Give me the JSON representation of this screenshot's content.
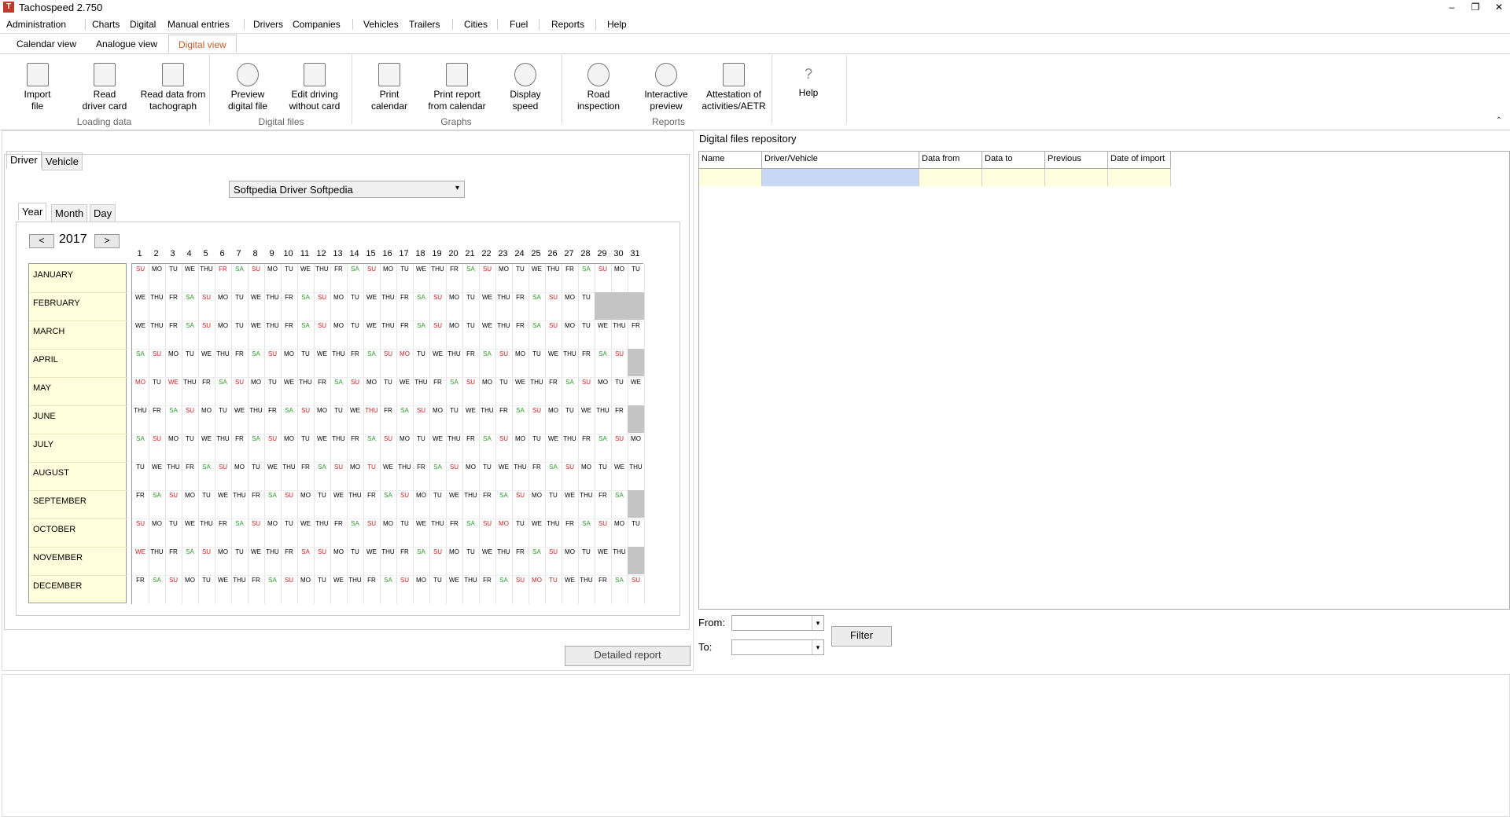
{
  "window": {
    "title": "Tachospeed 2.750",
    "minimize": "–",
    "restore": "❐",
    "close": "✕"
  },
  "menu": [
    {
      "label": "Administration"
    },
    {
      "label": "Charts"
    },
    {
      "label": "Digital"
    },
    {
      "label": "Manual entries"
    },
    {
      "label": "Drivers"
    },
    {
      "label": "Companies"
    },
    {
      "label": "Vehicles"
    },
    {
      "label": "Trailers"
    },
    {
      "label": "Cities"
    },
    {
      "label": "Fuel"
    },
    {
      "label": "Reports"
    },
    {
      "label": "Help"
    }
  ],
  "view_tabs": [
    {
      "label": "Calendar view"
    },
    {
      "label": "Analogue view"
    },
    {
      "label": "Digital view",
      "active": true
    }
  ],
  "ribbon": {
    "buttons": [
      {
        "line1": "Import",
        "line2": "file",
        "icon": "folder-icon"
      },
      {
        "line1": "Read",
        "line2": "driver card",
        "icon": "card-reader-icon"
      },
      {
        "line1": "Read data from",
        "line2": "tachograph",
        "icon": "tachograph-icon"
      },
      {
        "line1": "Preview",
        "line2": "digital file",
        "icon": "magnifier-icon"
      },
      {
        "line1": "Edit driving",
        "line2": "without card",
        "icon": "edit-card-icon"
      },
      {
        "line1": "Print",
        "line2": "calendar",
        "icon": "printer-icon"
      },
      {
        "line1": "Print report",
        "line2": "from calendar",
        "icon": "printer-icon"
      },
      {
        "line1": "Display",
        "line2": "speed",
        "icon": "speedometer-icon"
      },
      {
        "line1": "Road",
        "line2": "inspection",
        "icon": "officer-icon"
      },
      {
        "line1": "Interactive",
        "line2": "preview",
        "icon": "magnifier-chart-icon"
      },
      {
        "line1": "Attestation of",
        "line2": "activities/AETR",
        "icon": "document-icon"
      },
      {
        "line1": "Help",
        "line2": "",
        "icon": "question-icon"
      }
    ],
    "groups": [
      "Loading data",
      "Digital files",
      "Graphs",
      "Reports"
    ]
  },
  "left": {
    "tabs": [
      {
        "label": "Driver"
      },
      {
        "label": "Vehicle"
      }
    ],
    "driver_select": "Softpedia Driver Softpedia",
    "period_tabs": [
      {
        "label": "Year"
      },
      {
        "label": "Month"
      },
      {
        "label": "Day"
      }
    ],
    "prev": "<",
    "next": ">",
    "year": "2017",
    "detailed_report": "Detailed report"
  },
  "calendar": {
    "day_numbers": [
      "1",
      "2",
      "3",
      "4",
      "5",
      "6",
      "7",
      "8",
      "9",
      "10",
      "11",
      "12",
      "13",
      "14",
      "15",
      "16",
      "17",
      "18",
      "19",
      "20",
      "21",
      "22",
      "23",
      "24",
      "25",
      "26",
      "27",
      "28",
      "29",
      "30",
      "31"
    ],
    "months": [
      {
        "name": "JANUARY",
        "days": [
          "SU",
          "MO",
          "TU",
          "WE",
          "THU",
          "FR",
          "SA",
          "SU",
          "MO",
          "TU",
          "WE",
          "THU",
          "FR",
          "SA",
          "SU",
          "MO",
          "TU",
          "WE",
          "THU",
          "FR",
          "SA",
          "SU",
          "MO",
          "TU",
          "WE",
          "THU",
          "FR",
          "SA",
          "SU",
          "MO",
          "TU"
        ]
      },
      {
        "name": "FEBRUARY",
        "days": [
          "WE",
          "THU",
          "FR",
          "SA",
          "SU",
          "MO",
          "TU",
          "WE",
          "THU",
          "FR",
          "SA",
          "SU",
          "MO",
          "TU",
          "WE",
          "THU",
          "FR",
          "SA",
          "SU",
          "MO",
          "TU",
          "WE",
          "THU",
          "FR",
          "SA",
          "SU",
          "MO",
          "TU"
        ]
      },
      {
        "name": "MARCH",
        "days": [
          "WE",
          "THU",
          "FR",
          "SA",
          "SU",
          "MO",
          "TU",
          "WE",
          "THU",
          "FR",
          "SA",
          "SU",
          "MO",
          "TU",
          "WE",
          "THU",
          "FR",
          "SA",
          "SU",
          "MO",
          "TU",
          "WE",
          "THU",
          "FR",
          "SA",
          "SU",
          "MO",
          "TU",
          "WE",
          "THU",
          "FR"
        ]
      },
      {
        "name": "APRIL",
        "days": [
          "SA",
          "SU",
          "MO",
          "TU",
          "WE",
          "THU",
          "FR",
          "SA",
          "SU",
          "MO",
          "TU",
          "WE",
          "THU",
          "FR",
          "SA",
          "SU",
          "MO",
          "TU",
          "WE",
          "THU",
          "FR",
          "SA",
          "SU",
          "MO",
          "TU",
          "WE",
          "THU",
          "FR",
          "SA",
          "SU"
        ]
      },
      {
        "name": "MAY",
        "days": [
          "MO",
          "TU",
          "WE",
          "THU",
          "FR",
          "SA",
          "SU",
          "MO",
          "TU",
          "WE",
          "THU",
          "FR",
          "SA",
          "SU",
          "MO",
          "TU",
          "WE",
          "THU",
          "FR",
          "SA",
          "SU",
          "MO",
          "TU",
          "WE",
          "THU",
          "FR",
          "SA",
          "SU",
          "MO",
          "TU",
          "WE"
        ]
      },
      {
        "name": "JUNE",
        "days": [
          "THU",
          "FR",
          "SA",
          "SU",
          "MO",
          "TU",
          "WE",
          "THU",
          "FR",
          "SA",
          "SU",
          "MO",
          "TU",
          "WE",
          "THU",
          "FR",
          "SA",
          "SU",
          "MO",
          "TU",
          "WE",
          "THU",
          "FR",
          "SA",
          "SU",
          "MO",
          "TU",
          "WE",
          "THU",
          "FR"
        ]
      },
      {
        "name": "JULY",
        "days": [
          "SA",
          "SU",
          "MO",
          "TU",
          "WE",
          "THU",
          "FR",
          "SA",
          "SU",
          "MO",
          "TU",
          "WE",
          "THU",
          "FR",
          "SA",
          "SU",
          "MO",
          "TU",
          "WE",
          "THU",
          "FR",
          "SA",
          "SU",
          "MO",
          "TU",
          "WE",
          "THU",
          "FR",
          "SA",
          "SU",
          "MO"
        ]
      },
      {
        "name": "AUGUST",
        "days": [
          "TU",
          "WE",
          "THU",
          "FR",
          "SA",
          "SU",
          "MO",
          "TU",
          "WE",
          "THU",
          "FR",
          "SA",
          "SU",
          "MO",
          "TU",
          "WE",
          "THU",
          "FR",
          "SA",
          "SU",
          "MO",
          "TU",
          "WE",
          "THU",
          "FR",
          "SA",
          "SU",
          "MO",
          "TU",
          "WE",
          "THU"
        ]
      },
      {
        "name": "SEPTEMBER",
        "days": [
          "FR",
          "SA",
          "SU",
          "MO",
          "TU",
          "WE",
          "THU",
          "FR",
          "SA",
          "SU",
          "MO",
          "TU",
          "WE",
          "THU",
          "FR",
          "SA",
          "SU",
          "MO",
          "TU",
          "WE",
          "THU",
          "FR",
          "SA",
          "SU",
          "MO",
          "TU",
          "WE",
          "THU",
          "FR",
          "SA"
        ]
      },
      {
        "name": "OCTOBER",
        "days": [
          "SU",
          "MO",
          "TU",
          "WE",
          "THU",
          "FR",
          "SA",
          "SU",
          "MO",
          "TU",
          "WE",
          "THU",
          "FR",
          "SA",
          "SU",
          "MO",
          "TU",
          "WE",
          "THU",
          "FR",
          "SA",
          "SU",
          "MO",
          "TU",
          "WE",
          "THU",
          "FR",
          "SA",
          "SU",
          "MO",
          "TU"
        ]
      },
      {
        "name": "NOVEMBER",
        "days": [
          "WE",
          "THU",
          "FR",
          "SA",
          "SU",
          "MO",
          "TU",
          "WE",
          "THU",
          "FR",
          "SA",
          "SU",
          "MO",
          "TU",
          "WE",
          "THU",
          "FR",
          "SA",
          "SU",
          "MO",
          "TU",
          "WE",
          "THU",
          "FR",
          "SA",
          "SU",
          "MO",
          "TU",
          "WE",
          "THU"
        ]
      },
      {
        "name": "DECEMBER",
        "days": [
          "FR",
          "SA",
          "SU",
          "MO",
          "TU",
          "WE",
          "THU",
          "FR",
          "SA",
          "SU",
          "MO",
          "TU",
          "WE",
          "THU",
          "FR",
          "SA",
          "SU",
          "MO",
          "TU",
          "WE",
          "THU",
          "FR",
          "SA",
          "SU",
          "MO",
          "TU",
          "WE",
          "THU",
          "FR",
          "SA",
          "SU"
        ]
      }
    ],
    "holidays": [
      [
        0,
        0
      ],
      [
        0,
        5
      ],
      [
        3,
        16
      ],
      [
        4,
        0
      ],
      [
        4,
        2
      ],
      [
        5,
        14
      ],
      [
        7,
        14
      ],
      [
        9,
        22
      ],
      [
        10,
        0
      ],
      [
        10,
        10
      ],
      [
        11,
        24
      ],
      [
        11,
        25
      ]
    ],
    "colors": {
      "saturday": "#2a9a2a",
      "sunday": "#d02020",
      "month_bg": "#ffffdd",
      "unused": "#c4c4c4"
    }
  },
  "repository": {
    "title": "Digital files repository",
    "columns": [
      "Name",
      "Driver/Vehicle",
      "Data from",
      "Data to",
      "Previous",
      "Date of import"
    ],
    "from_label": "From:",
    "to_label": "To:",
    "filter": "Filter"
  }
}
